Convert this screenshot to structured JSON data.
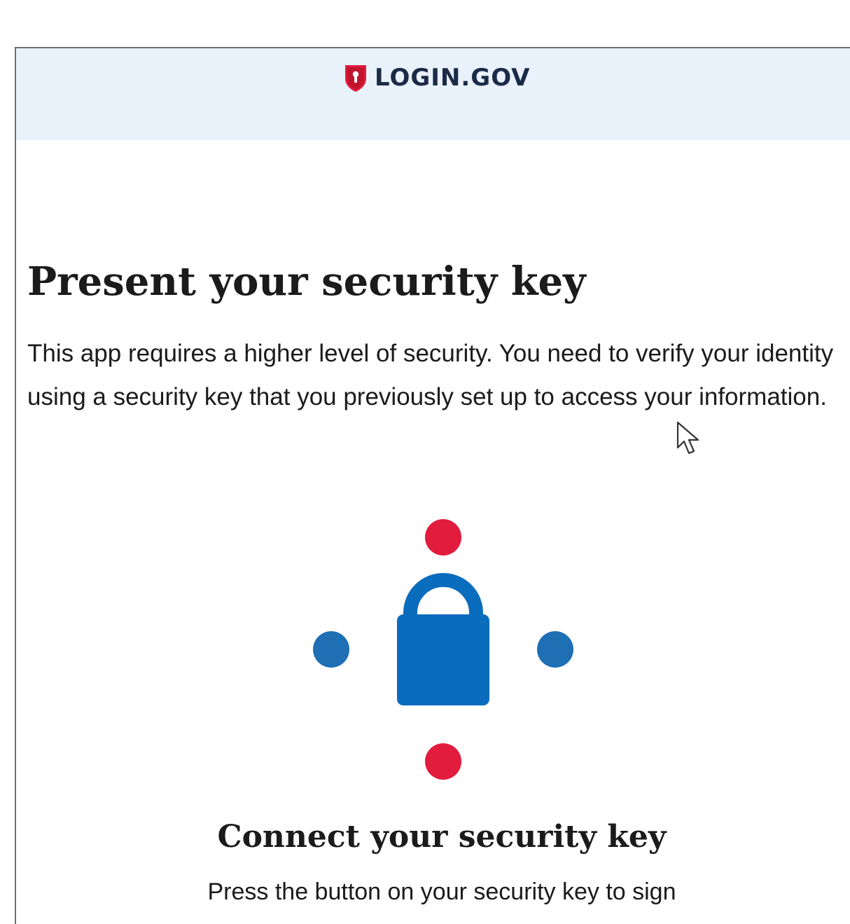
{
  "header": {
    "logo_text": "LOGIN.GOV"
  },
  "main": {
    "title": "Present your security key",
    "lead": "This app requires a higher level of security. You need to verify your identity using a security key that you previously set up to access your information.",
    "illustration": {
      "icon": "lock-icon",
      "dot_colors": {
        "vertical": "#e21c3d",
        "horizontal": "#1f6fb5"
      },
      "lock_color": "#0a6cbc"
    },
    "subtitle": "Connect your security key",
    "instruction": "Press the button on your security key to sign"
  },
  "colors": {
    "header_bg": "#e9f2fb",
    "brand_red": "#e21c3d",
    "brand_navy": "#1b2b47",
    "accent_blue": "#0a6cbc"
  }
}
